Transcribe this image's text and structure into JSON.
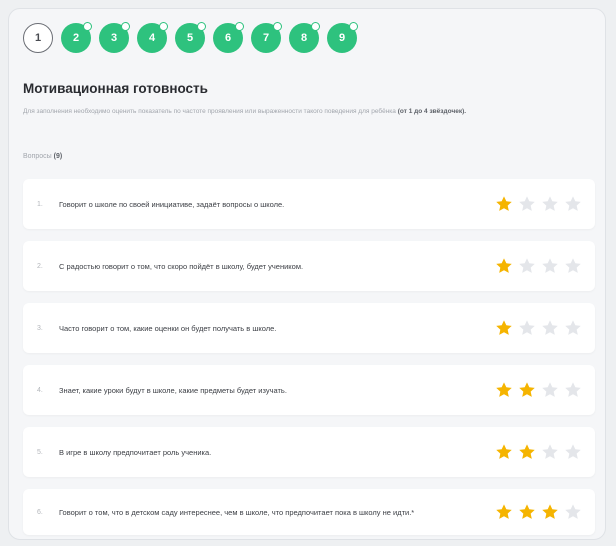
{
  "steps": [
    {
      "label": "1",
      "state": "current"
    },
    {
      "label": "2",
      "state": "done"
    },
    {
      "label": "3",
      "state": "done"
    },
    {
      "label": "4",
      "state": "done"
    },
    {
      "label": "5",
      "state": "done"
    },
    {
      "label": "6",
      "state": "done"
    },
    {
      "label": "7",
      "state": "done"
    },
    {
      "label": "8",
      "state": "done"
    },
    {
      "label": "9",
      "state": "done"
    }
  ],
  "section": {
    "title": "Мотивационная готовность",
    "description": "Для заполнения необходимо оценить показатель по частоте проявления или выраженности такого поведения для ребёнка",
    "description_bold": "(от 1 до 4 звёздочек).",
    "questions_label": "Вопросы",
    "questions_count": "(9)"
  },
  "questions": [
    {
      "num": "1.",
      "text": "Говорит о школе по своей инициативе, задаёт вопросы о школе.",
      "rating": 1
    },
    {
      "num": "2.",
      "text": "С радостью говорит о том, что скоро пойдёт в школу, будет учеником.",
      "rating": 1
    },
    {
      "num": "3.",
      "text": "Часто говорит о том, какие оценки он будет получать в школе.",
      "rating": 1
    },
    {
      "num": "4.",
      "text": "Знает, какие уроки будут в школе, какие предметы будет изучать.",
      "rating": 2
    },
    {
      "num": "5.",
      "text": "В игре в школу предпочитает роль ученика.",
      "rating": 2
    },
    {
      "num": "6.",
      "text": "Говорит о том, что в детском саду интереснее, чем в школе, что предпочитает пока в школу не идти.*",
      "rating": 3
    }
  ],
  "max_rating": 4,
  "colors": {
    "step_done": "#2ec27e",
    "star_on": "#f5b400",
    "star_off": "#e4e6ea"
  }
}
